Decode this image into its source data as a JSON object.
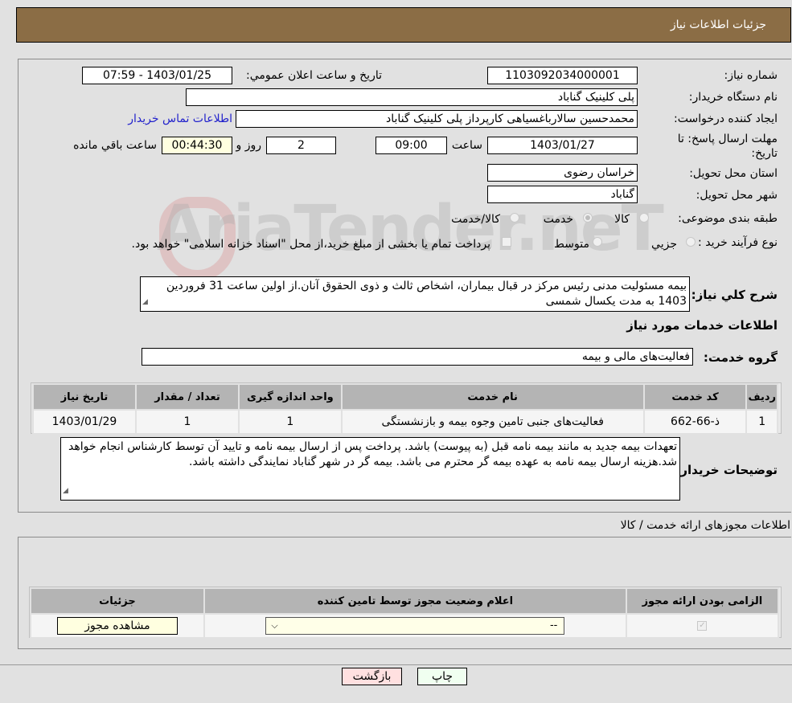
{
  "header": {
    "title": "جزئیات اطلاعات نیاز"
  },
  "form": {
    "need_number_label": "شماره نیاز:",
    "need_number": "1103092034000001",
    "announce_label": "تاریخ و ساعت اعلان عمومي:",
    "announce_value": "1403/01/25 - 07:59",
    "buyer_org_label": "نام دستگاه خریدار:",
    "buyer_org": "پلی کلینیک گناباد",
    "creator_label": "ایجاد کننده درخواست:",
    "creator": "محمدحسین سالارباغسیاهی کارپرداز پلی کلینیک گناباد",
    "contact_link": "اطلاعات تماس خریدار",
    "deadline_label": "مهلت ارسال پاسخ: تا تاریخ:",
    "deadline_date": "1403/01/27",
    "time_label": "ساعت",
    "deadline_time": "09:00",
    "days_value": "2",
    "days_label": "روز و",
    "remaining_time": "00:44:30",
    "remaining_label": "ساعت باقي مانده",
    "province_label": "استان محل تحویل:",
    "province": "خراسان رضوی",
    "city_label": "شهر محل تحویل:",
    "city": "گناباد",
    "category_label": "طبقه بندی موضوعی:",
    "category_options": [
      "کالا",
      "خدمت",
      "کالا/خدمت"
    ],
    "category_selected": "خدمت",
    "process_label": "نوع فرآیند خرید :",
    "process_options": [
      "جزیي",
      "متوسط"
    ],
    "treasury_note": "پرداخت تمام یا بخشی از مبلغ خرید،از محل \"اسناد خزانه اسلامی\" خواهد بود.",
    "summary_label": "شرح کلي نیاز:",
    "summary": "بیمه مسئولیت مدنی رئیس مرکز در قبال بیماران، اشخاص ثالث و ذوی الحقوق آنان.از اولین ساعت 31 فروردین 1403 به مدت یکسال شمسی",
    "services_heading": "اطلاعات خدمات مورد نیاز",
    "service_group_label": "گروه خدمت:",
    "service_group": "فعالیت‌های مالی و بیمه"
  },
  "services_table": {
    "headers": [
      "ردیف",
      "کد خدمت",
      "نام خدمت",
      "واحد اندازه گیری",
      "تعداد / مقدار",
      "تاریخ نیاز"
    ],
    "rows": [
      [
        "1",
        "ذ-66-662",
        "فعالیت‌های جنبی تامین وجوه بیمه و بازنشستگی",
        "1",
        "1",
        "1403/01/29"
      ]
    ]
  },
  "buyer_notes_label": "توضیحات خریدار:",
  "buyer_notes": "تعهدات بیمه جدید به مانند بیمه نامه قبل (به پیوست) باشد. پرداخت پس از ارسال بیمه نامه و تایید آن توسط کارشناس انجام خواهد شد.هزینه ارسال بیمه نامه به عهده بیمه گر محترم می باشد. بیمه گر در شهر گناباد نمایندگی داشته باشد.",
  "permits": {
    "heading": "اطلاعات مجوزهای ارائه خدمت / کالا",
    "headers": [
      "الزامی بودن ارائه مجوز",
      "اعلام وضعیت مجوز توسط تامین کننده",
      "جزئیات"
    ],
    "required_checked": true,
    "status_value": "--",
    "view_button": "مشاهده مجوز"
  },
  "buttons": {
    "print": "چاپ",
    "back": "بازگشت"
  },
  "watermark": "AriaTender.neT"
}
